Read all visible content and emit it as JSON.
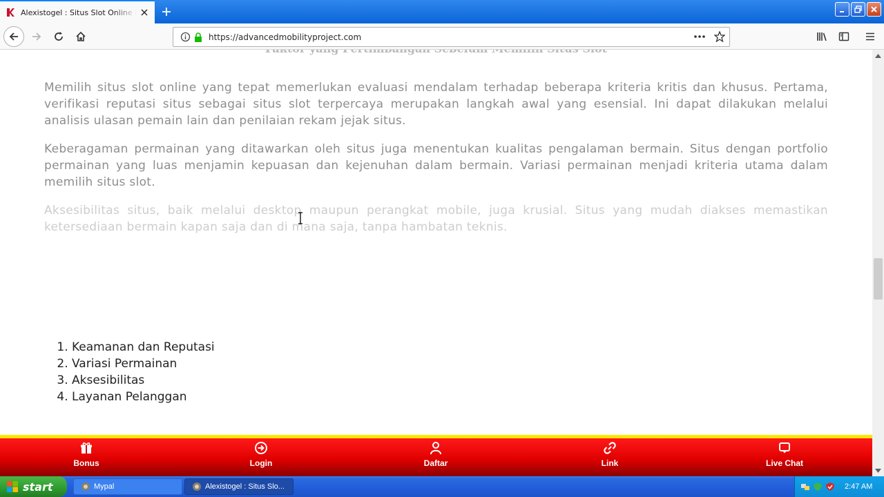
{
  "browser": {
    "tab_title": "Alexistogel : Situs Slot Online Dengan Kriteria Terbaik",
    "url": "https://advancedmobilityproject.com"
  },
  "article": {
    "heading_cut": "Faktor yang Pertimbangan Sebelum Memilih Situs Slot",
    "paragraphs": [
      "Memilih situs slot online yang tepat memerlukan evaluasi mendalam terhadap beberapa kriteria kritis dan khusus. Pertama, verifikasi reputasi situs sebagai situs slot terpercaya merupakan langkah awal yang esensial. Ini dapat dilakukan melalui analisis ulasan pemain lain dan penilaian rekam jejak situs.",
      "Keberagaman permainan yang ditawarkan oleh situs juga menentukan kualitas pengalaman bermain. Situs dengan portfolio permainan yang luas menjamin kepuasan dan kejenuhan dalam bermain. Variasi permainan menjadi kriteria utama dalam memilih situs slot.",
      "Aksesibilitas situs, baik melalui desktop maupun perangkat mobile, juga krusial. Situs yang mudah diakses memastikan ketersediaan bermain kapan saja dan di mana saja, tanpa hambatan teknis."
    ],
    "criteria": [
      "Keamanan dan Reputasi",
      "Variasi Permainan",
      "Aksesibilitas",
      "Layanan Pelanggan"
    ]
  },
  "bottom_nav": {
    "items": [
      {
        "label": "Bonus",
        "icon": "gift-icon"
      },
      {
        "label": "Login",
        "icon": "login-icon"
      },
      {
        "label": "Daftar",
        "icon": "user-icon"
      },
      {
        "label": "Link",
        "icon": "link-icon"
      },
      {
        "label": "Live Chat",
        "icon": "chat-icon"
      }
    ]
  },
  "taskbar": {
    "start_label": "start",
    "items": [
      {
        "label": "Mypal"
      },
      {
        "label": "Alexistogel : Situs Slo..."
      }
    ],
    "clock": "2:47 AM"
  },
  "colors": {
    "accent_red": "#e00000",
    "accent_yellow": "#ffe600",
    "browser_blue": "#0a64d6"
  }
}
